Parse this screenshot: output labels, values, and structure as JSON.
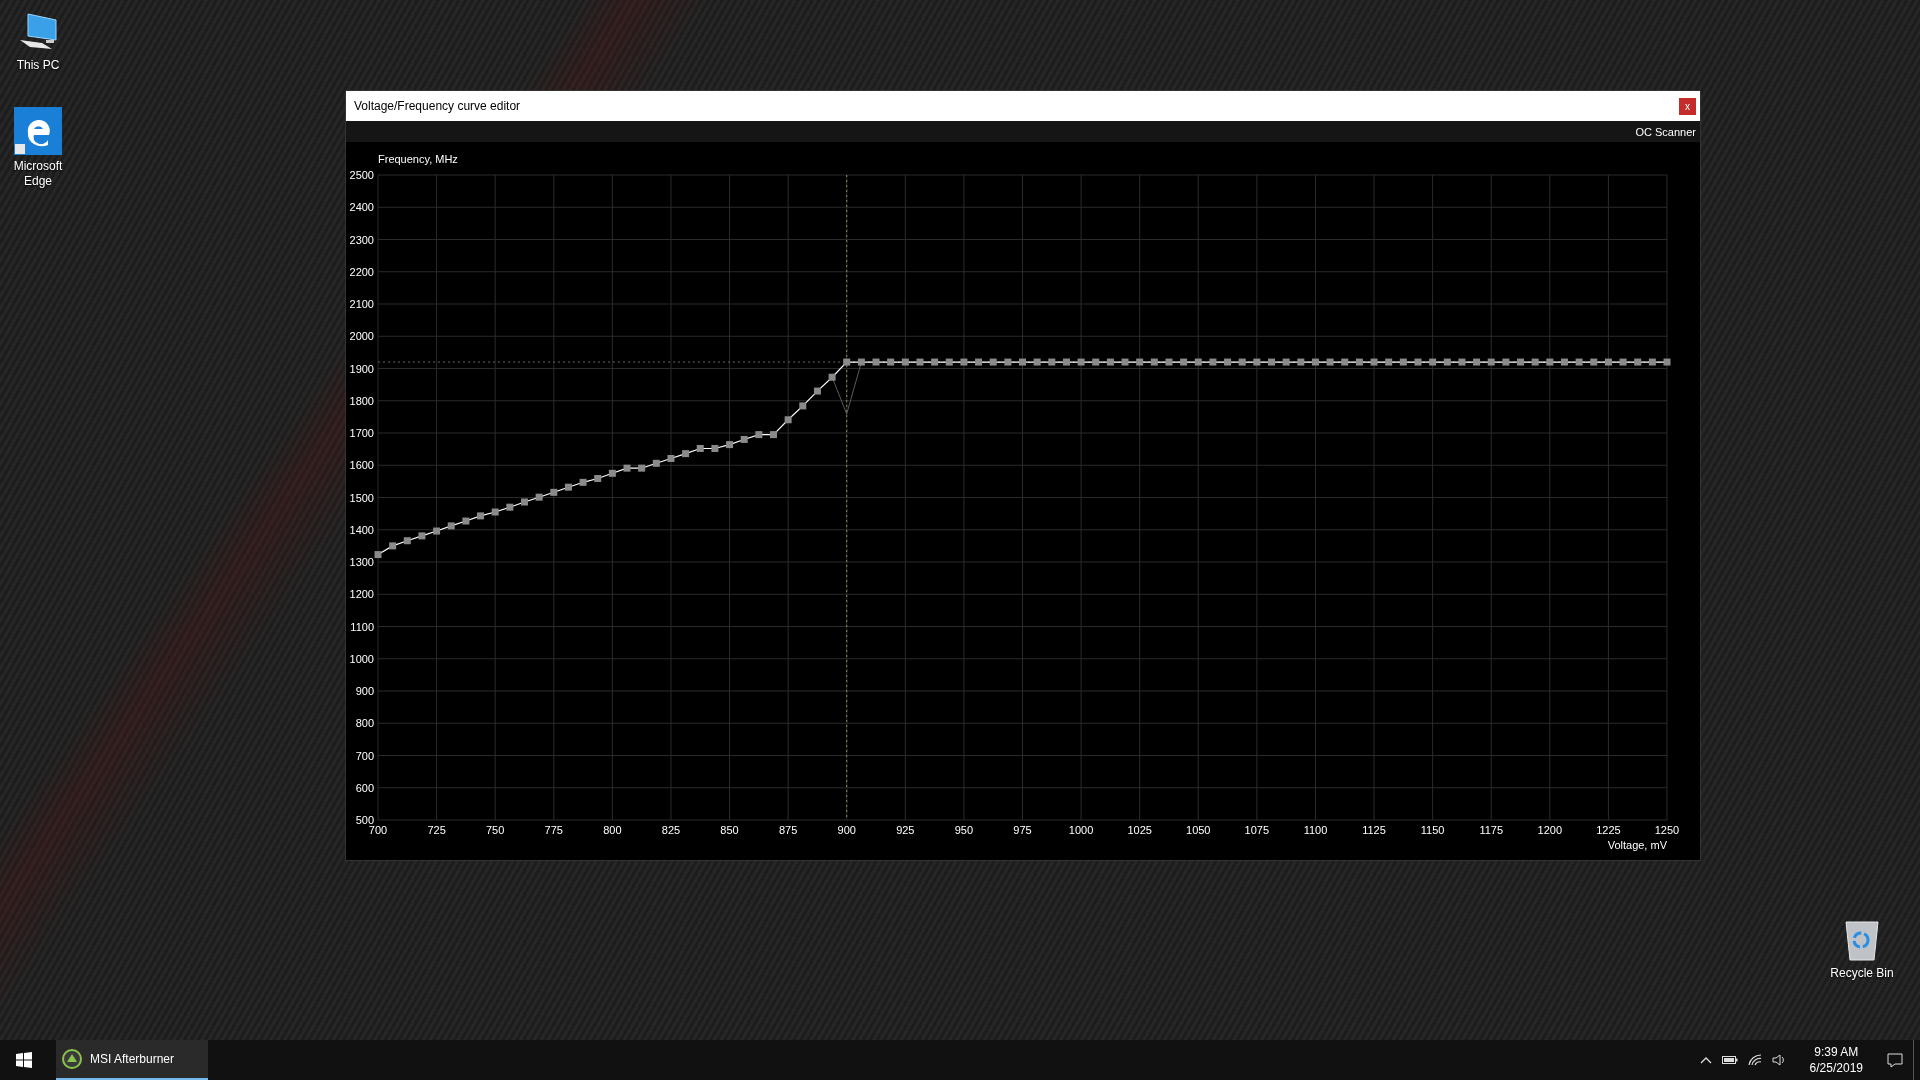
{
  "desktop_icons": [
    {
      "label": "This PC",
      "kind": "computer"
    },
    {
      "label": "Microsoft Edge",
      "kind": "edge"
    },
    {
      "label": "Recycle Bin",
      "kind": "recycle"
    }
  ],
  "window": {
    "title": "Voltage/Frequency curve editor",
    "close_label": "x",
    "toolbar_button": "OC Scanner",
    "chart_data": {
      "type": "line",
      "xlabel": "Voltage, mV",
      "ylabel": "Frequency, MHz",
      "x": [
        700,
        706.25,
        712.5,
        718.75,
        725,
        731.25,
        737.5,
        743.75,
        750,
        756.25,
        762.5,
        768.75,
        775,
        781.25,
        787.5,
        793.75,
        800,
        806.25,
        812.5,
        818.75,
        825,
        831.25,
        837.5,
        843.75,
        850,
        856.25,
        862.5,
        868.75,
        875,
        881.25,
        887.5,
        893.75,
        900,
        906.25,
        912.5,
        918.75,
        925,
        931.25,
        937.5,
        943.75,
        950,
        956.25,
        962.5,
        968.75,
        975,
        981.25,
        987.5,
        993.75,
        1000,
        1006.25,
        1012.5,
        1018.75,
        1025,
        1031.25,
        1037.5,
        1043.75,
        1050,
        1056.25,
        1062.5,
        1068.75,
        1075,
        1081.25,
        1087.5,
        1093.75,
        1100,
        1106.25,
        1112.5,
        1118.75,
        1125,
        1131.25,
        1137.5,
        1143.75,
        1150,
        1156.25,
        1162.5,
        1168.75,
        1175,
        1181.25,
        1187.5,
        1193.75,
        1200,
        1206.25,
        1212.5,
        1218.75,
        1225,
        1231.25,
        1237.5,
        1243.75,
        1250
      ],
      "series": [
        {
          "color": "#ffffff",
          "marker": "square",
          "values": [
            1323,
            1350,
            1366,
            1381,
            1396,
            1412,
            1427,
            1443,
            1455,
            1470,
            1486,
            1501,
            1516,
            1532,
            1547,
            1559,
            1575,
            1591,
            1591,
            1606,
            1621,
            1636,
            1652,
            1652,
            1664,
            1680,
            1695,
            1695,
            1741,
            1784,
            1830,
            1873,
            1920,
            1920,
            1920,
            1920,
            1920,
            1920,
            1920,
            1920,
            1920,
            1920,
            1920,
            1920,
            1920,
            1920,
            1920,
            1920,
            1920,
            1920,
            1920,
            1920,
            1920,
            1920,
            1920,
            1920,
            1920,
            1920,
            1920,
            1920,
            1920,
            1920,
            1920,
            1920,
            1920,
            1920,
            1920,
            1920,
            1920,
            1920,
            1920,
            1920,
            1920,
            1920,
            1920,
            1920,
            1920,
            1920,
            1920,
            1920,
            1920,
            1920,
            1920,
            1920,
            1920,
            1920,
            1920,
            1920,
            1920
          ]
        },
        {
          "color": "#5a5a5a",
          "values": [
            null,
            null,
            null,
            null,
            null,
            null,
            null,
            null,
            null,
            null,
            null,
            null,
            null,
            null,
            null,
            null,
            null,
            null,
            null,
            null,
            null,
            null,
            null,
            null,
            null,
            null,
            null,
            null,
            null,
            null,
            null,
            1873,
            1759,
            1920,
            null,
            null,
            null,
            null,
            null,
            null,
            null,
            null,
            null,
            null,
            null,
            null,
            null,
            null,
            null,
            null,
            null,
            null,
            null,
            null,
            null,
            null,
            null,
            null,
            null,
            null,
            null,
            null,
            null,
            null,
            null,
            null,
            null,
            null,
            null,
            null,
            null,
            null,
            null,
            null,
            null,
            null,
            null,
            null,
            null,
            null,
            null,
            null,
            null,
            null,
            null,
            null,
            null,
            null,
            null
          ]
        }
      ],
      "xlim": [
        700,
        1250
      ],
      "ylim": [
        500,
        2500
      ],
      "xticks": [
        700,
        725,
        750,
        775,
        800,
        825,
        850,
        875,
        900,
        925,
        950,
        975,
        1000,
        1025,
        1050,
        1075,
        1100,
        1125,
        1150,
        1175,
        1200,
        1225,
        1250
      ],
      "yticks": [
        500,
        600,
        700,
        800,
        900,
        1000,
        1100,
        1200,
        1300,
        1400,
        1500,
        1600,
        1700,
        1800,
        1900,
        2000,
        2100,
        2200,
        2300,
        2400,
        2500
      ],
      "grid": true,
      "ref_lines": [
        {
          "axis": "x",
          "value": 900
        },
        {
          "axis": "y",
          "value": 1920
        }
      ]
    }
  },
  "taskbar": {
    "apps": [
      {
        "label": "MSI Afterburner",
        "active": true
      }
    ],
    "time": "9:39 AM",
    "date": "6/25/2019"
  }
}
